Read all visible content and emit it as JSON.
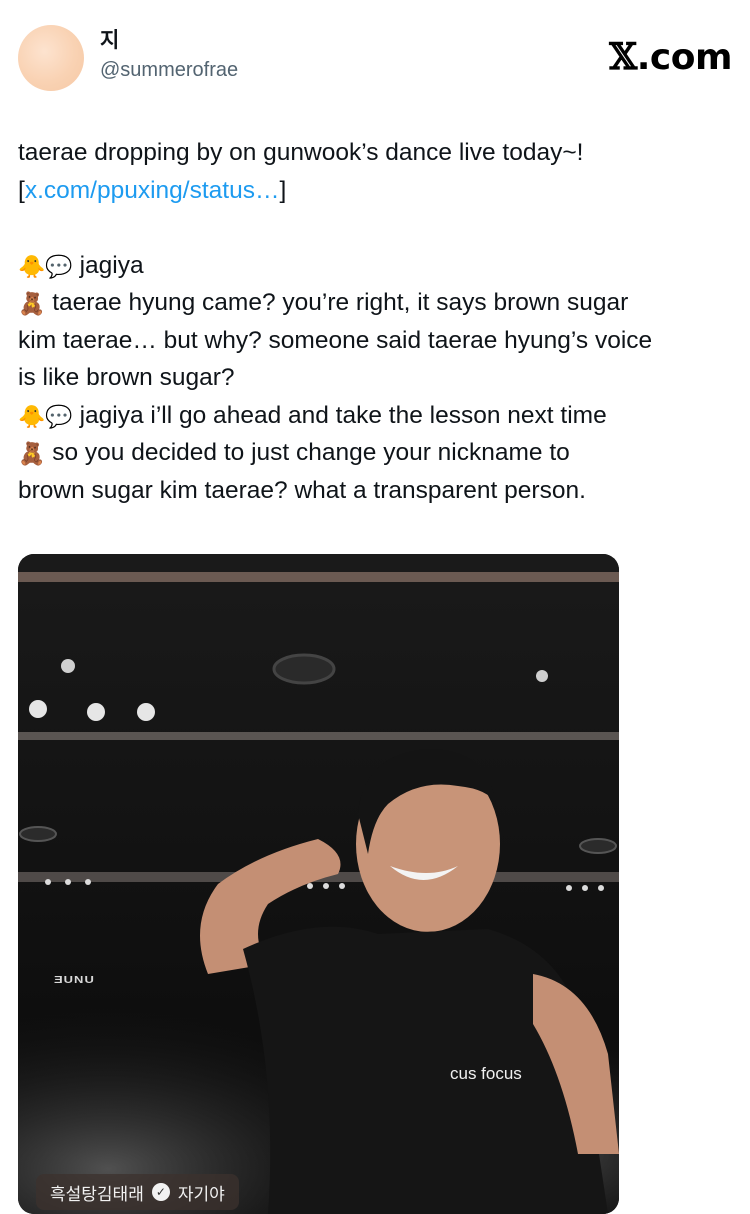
{
  "author": {
    "display_name": "지",
    "handle": "@summerofrae"
  },
  "brand": {
    "x_mark": "𝕏",
    "domain": ".com"
  },
  "tweet": {
    "line1": "taerae dropping by on gunwook’s dance live today~!",
    "link_open": "[",
    "link_text": "x.com/ppuxing/status…",
    "link_close": "]",
    "dialogue": [
      {
        "emoji": "🐥💬",
        "text": " jagiya"
      },
      {
        "emoji": "🧸",
        "text": " taerae hyung came? you’re right, it says brown sugar"
      },
      {
        "emoji": "",
        "text": "kim taerae… but why? someone said taerae hyung’s voice"
      },
      {
        "emoji": "",
        "text": "is like brown sugar?"
      },
      {
        "emoji": "🐥💬",
        "text": " jagiya i’ll go ahead and take the lesson next time"
      },
      {
        "emoji": "🧸",
        "text": " so you decided to just change your nickname to"
      },
      {
        "emoji": "",
        "text": "brown sugar kim taerae? what a transparent person."
      }
    ]
  },
  "media": {
    "watermark": "ƎUNU",
    "overlay_text": "cus focus",
    "chip_name": "흑설탕김태래",
    "chip_suffix": "자기야",
    "accent_color": "#1d9bf0"
  }
}
